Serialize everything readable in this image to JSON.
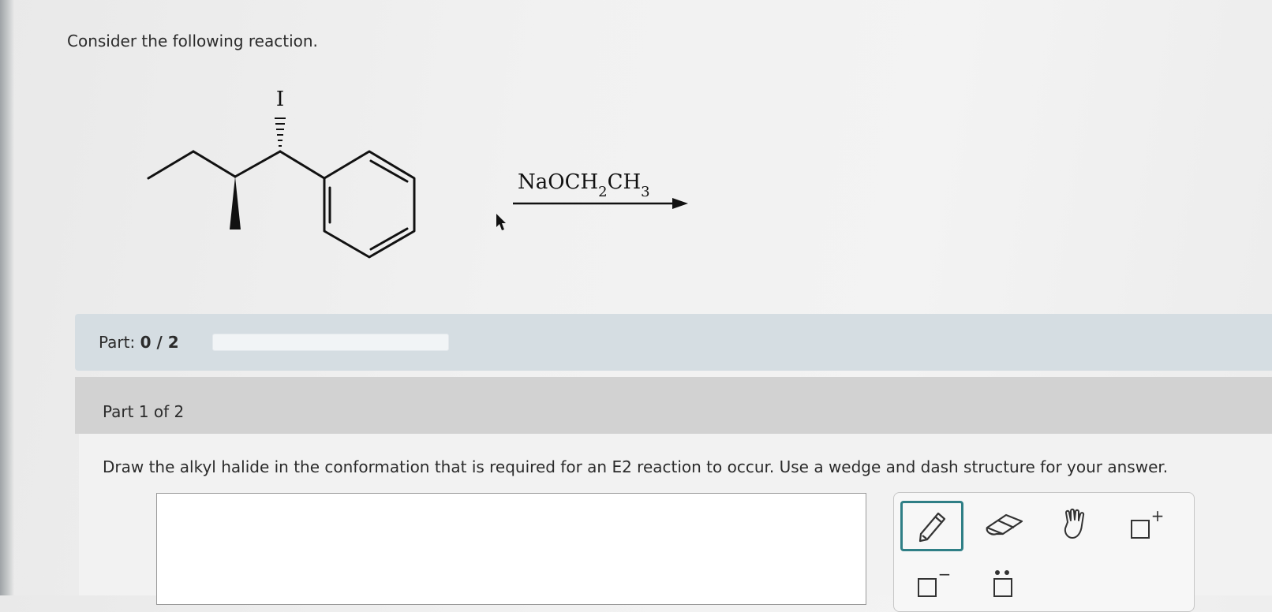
{
  "prompt": "Consider the following reaction.",
  "reagent": {
    "prefix": "NaOCH",
    "sub1": "2",
    "mid": "CH",
    "sub2": "3"
  },
  "molecule": {
    "halogen_label": "I"
  },
  "part_progress": {
    "label": "Part:",
    "value": "0 / 2",
    "fraction_complete": 0
  },
  "part_header": "Part 1 of 2",
  "question": "Draw the alkyl halide in the conformation that is required for an E2 reaction to occur. Use a wedge and dash structure for your answer.",
  "toolbar": {
    "tools": [
      "pencil-icon",
      "eraser-icon",
      "hand-icon",
      "add-charge-icon",
      "remove-charge-icon",
      "lone-pair-icon"
    ],
    "selected": "pencil-icon",
    "plus_symbol": "+",
    "minus_symbol": "−"
  },
  "colors": {
    "accent": "#2f7f86",
    "part_bar": "#d5dde2",
    "part_header": "#d2d2d2"
  }
}
